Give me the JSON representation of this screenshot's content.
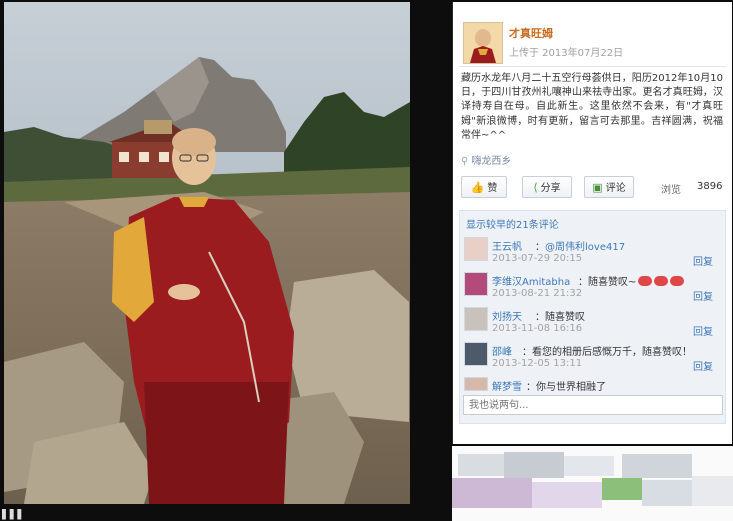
{
  "post": {
    "username": "才真旺姆",
    "time": "上传于 2013年07月22日",
    "text": "藏历水龙年八月二十五空行母荟供日，阳历2012年10月10日，于四川甘孜州礼嚷神山来祛寺出家。更名才真旺姆，汉译持寿自在母。自此新生。这里依然不会来，有\"才真旺姆\"新浪微博，时有更新，留言可去那里。吉祥圆满，祝福常伴~^^",
    "location": "嗨龙西乡"
  },
  "actions": {
    "like": "赞",
    "share": "分享",
    "comment": "评论",
    "views_label": "浏览",
    "views_count": "3896"
  },
  "comments": {
    "header": "显示较早的21条评论",
    "items": [
      {
        "name": "王云帆",
        "text_prefix": "：",
        "mention": "@周伟利love417",
        "text": "",
        "time": "2013-07-29 20:15",
        "reply": "回复"
      },
      {
        "name": "李维汉Amitabha",
        "text_prefix": "：",
        "mention": "",
        "text": "随喜赞叹~",
        "time": "2013-08-21 21:32",
        "reply": "回复"
      },
      {
        "name": "刘扬天",
        "text_prefix": "：",
        "mention": "",
        "text": "随喜赞叹",
        "time": "2013-11-08 16:16",
        "reply": "回复"
      },
      {
        "name": "邵峰",
        "text_prefix": "：",
        "mention": "",
        "text": "看您的相册后感慨万千，随喜赞叹！",
        "time": "2013-12-05 13:11",
        "reply": "回复"
      },
      {
        "name": "解梦雪",
        "text_prefix": "：",
        "mention": "",
        "text": "你与世界相融了",
        "time": "",
        "reply": ""
      }
    ],
    "input_placeholder": "我也说两句..."
  },
  "colors": {
    "username": "#c96a20",
    "link": "#3f77b8",
    "robe": "#9b1c1f",
    "robe_yellow": "#e2a93a"
  }
}
